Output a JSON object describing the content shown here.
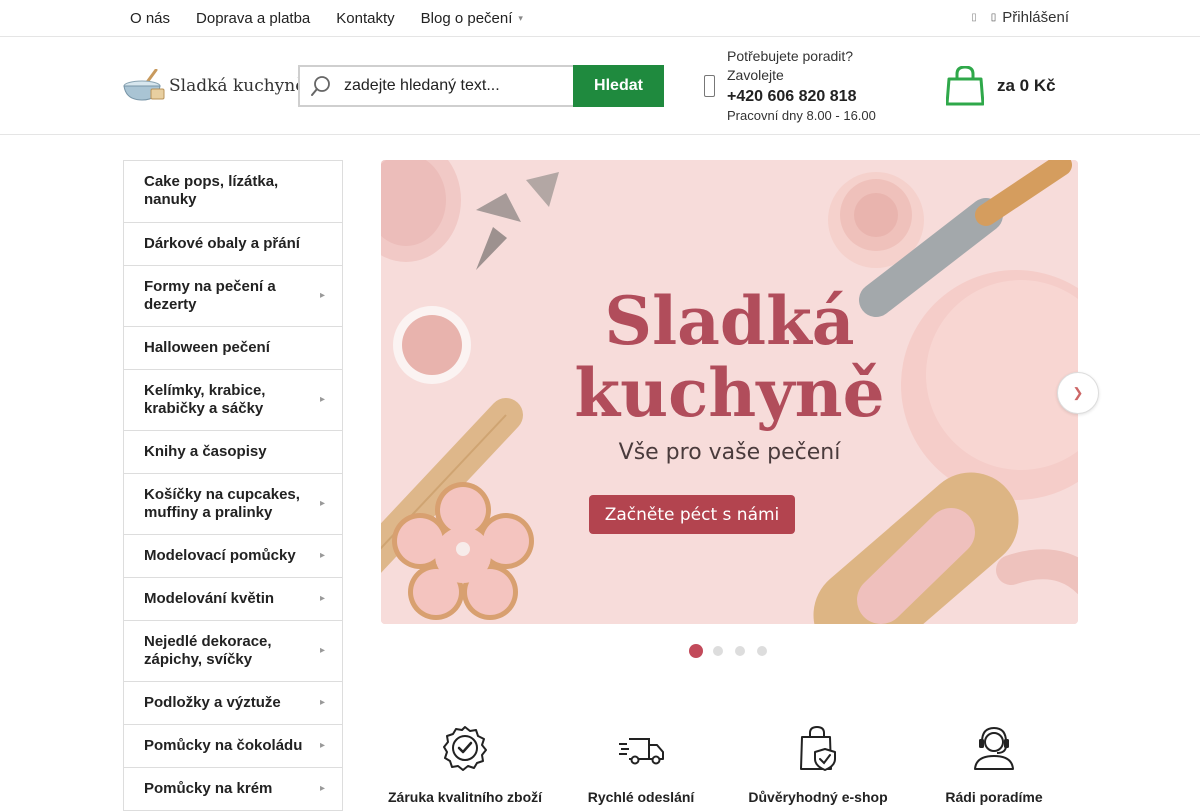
{
  "topnav": {
    "items": [
      {
        "label": "O nás"
      },
      {
        "label": "Doprava a platba"
      },
      {
        "label": "Kontakty"
      },
      {
        "label": "Blog o pečení"
      }
    ],
    "login_label": "Přihlášení"
  },
  "header": {
    "logo_text": "Sladká kuchyně",
    "search": {
      "placeholder": "zadejte hledaný text...",
      "button_label": "Hledat"
    },
    "contact": {
      "line1": "Potřebujete poradit?",
      "line2": "Zavolejte",
      "phone": "+420 606 820 818",
      "hours": "Pracovní dny 8.00 - 16.00"
    },
    "cart_total": "za 0 Kč"
  },
  "categories": [
    {
      "label": "Cake pops, lízátka, nanuky",
      "has_sub": false
    },
    {
      "label": "Dárkové obaly a přání",
      "has_sub": false
    },
    {
      "label": "Formy na pečení a dezerty",
      "has_sub": true
    },
    {
      "label": "Halloween pečení",
      "has_sub": false
    },
    {
      "label": "Kelímky, krabice, krabičky a sáčky",
      "has_sub": true
    },
    {
      "label": "Knihy a časopisy",
      "has_sub": false
    },
    {
      "label": "Košíčky na cupcakes, muffiny a pralinky",
      "has_sub": true
    },
    {
      "label": "Modelovací pomůcky",
      "has_sub": true
    },
    {
      "label": "Modelování květin",
      "has_sub": true
    },
    {
      "label": "Nejedlé dekorace, zápichy, svíčky",
      "has_sub": true
    },
    {
      "label": "Podložky a výztuže",
      "has_sub": true
    },
    {
      "label": "Pomůcky na čokoládu",
      "has_sub": true
    },
    {
      "label": "Pomůcky na krém",
      "has_sub": true
    }
  ],
  "banner": {
    "title_line1": "Sladká",
    "title_line2": "kuchyně",
    "subtitle": "Vše pro vaše pečení",
    "cta_label": "Začněte péct s námi",
    "slide_count": 4,
    "active_slide": 1
  },
  "features": [
    {
      "icon": "quality-badge-icon",
      "label": "Záruka kvalitního zboží"
    },
    {
      "icon": "delivery-truck-icon",
      "label": "Rychlé odeslání"
    },
    {
      "icon": "secure-bag-icon",
      "label": "Důvěryhodný e-shop"
    },
    {
      "icon": "support-agent-icon",
      "label": "Rádi poradíme"
    }
  ],
  "colors": {
    "accent_green": "#1f8a3e",
    "brand_rose": "#b14d5b",
    "cta_rose": "#b3444f"
  }
}
